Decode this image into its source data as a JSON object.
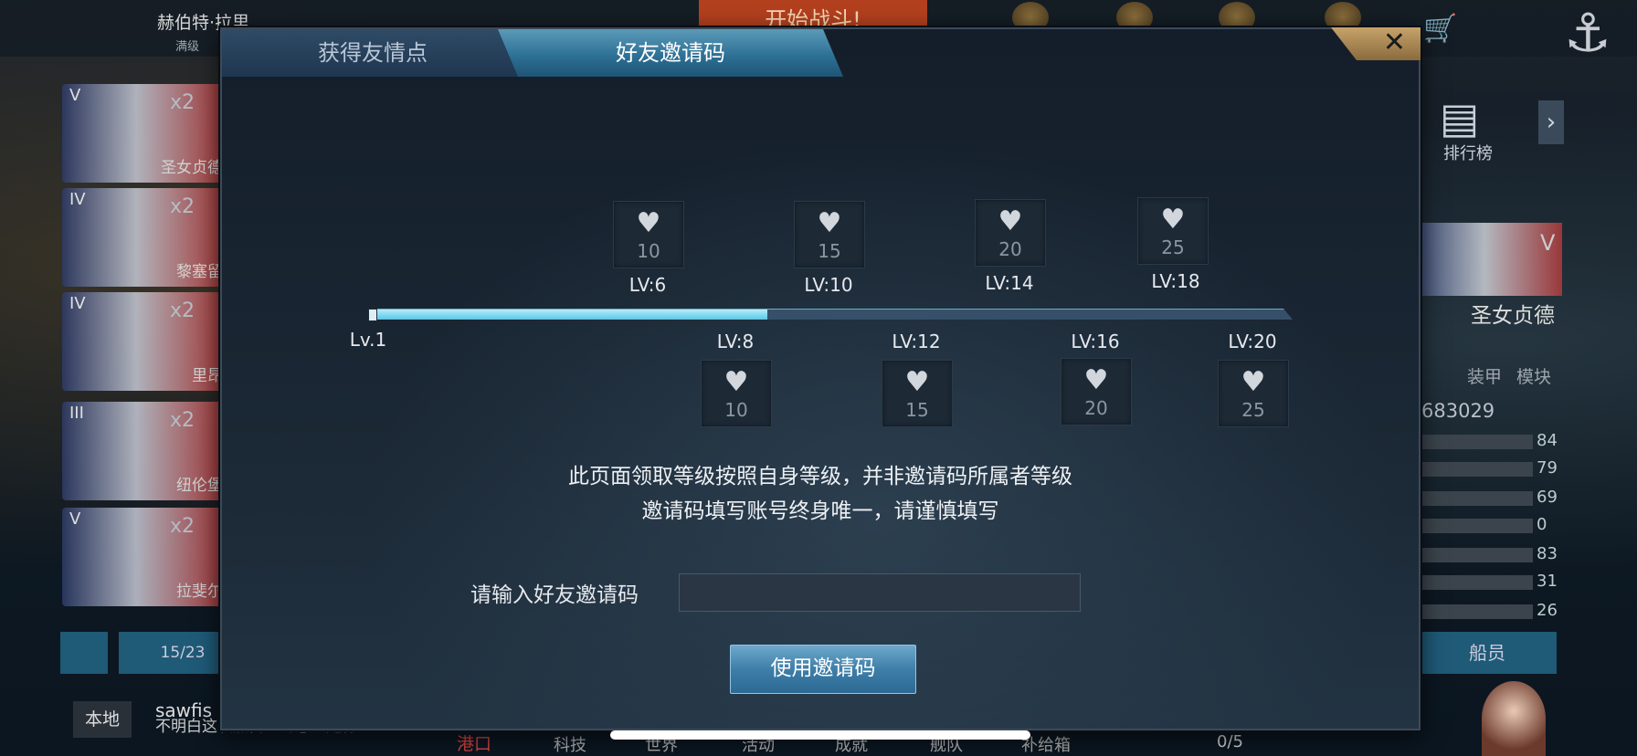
{
  "background": {
    "player_name": "赫伯特·拉里",
    "player_sub": "满级",
    "start_battle": "开始战斗!",
    "ships": [
      {
        "tier": "V",
        "count": "x2",
        "name": "圣女贞德"
      },
      {
        "tier": "IV",
        "count": "x2",
        "name": "黎塞留"
      },
      {
        "tier": "IV",
        "count": "x2",
        "name": "里昂"
      },
      {
        "tier": "III",
        "count": "x2",
        "name": "纽伦堡"
      },
      {
        "tier": "V",
        "count": "x2",
        "name": "拉斐尔"
      }
    ],
    "ship_count": "15/23",
    "local_btn": "本地",
    "chat_name": "sawfis",
    "chat_text": "不明白这次加雷匹的意义是什么",
    "bottom_nav": [
      "港口",
      "科技",
      "世界",
      "活动",
      "成就",
      "舰队",
      "补给箱"
    ],
    "right_tier": "V",
    "right_ship_name": "圣女贞德",
    "rank_label": "排行榜",
    "right_tabs": [
      "装甲",
      "模块"
    ],
    "right_id": "683029",
    "stats": [
      "84",
      "79",
      "69",
      "0",
      "83",
      "31",
      "26"
    ],
    "crew_btn": "船员",
    "page_counter": "0/5"
  },
  "modal": {
    "tabs": [
      {
        "label": "获得友情点",
        "active": false
      },
      {
        "label": "好友邀请码",
        "active": true
      }
    ],
    "close_icon": "close-icon",
    "progress": {
      "start_label": "Lv.1",
      "fill_fraction": 0.43,
      "top_rewards": [
        {
          "amount": "10",
          "level": "LV:6"
        },
        {
          "amount": "15",
          "level": "LV:10"
        },
        {
          "amount": "20",
          "level": "LV:14"
        },
        {
          "amount": "25",
          "level": "LV:18"
        }
      ],
      "bottom_rewards": [
        {
          "amount": "10",
          "level": "LV:8"
        },
        {
          "amount": "15",
          "level": "LV:12"
        },
        {
          "amount": "20",
          "level": "LV:16"
        },
        {
          "amount": "25",
          "level": "LV:20"
        }
      ]
    },
    "notice_line1": "此页面领取等级按照自身等级，并非邀请码所属者等级",
    "notice_line2": "邀请码填写账号终身唯一，请谨慎填写",
    "input_label": "请输入好友邀请码",
    "input_value": "",
    "input_placeholder": "",
    "use_button": "使用邀请码"
  }
}
